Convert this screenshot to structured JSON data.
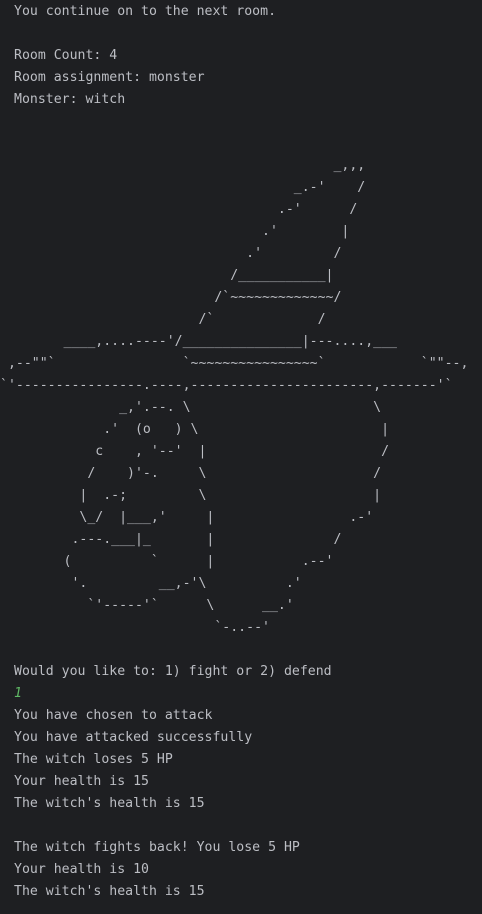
{
  "console": {
    "intro": "You continue on to the next room.",
    "room_count": "Room Count: 4",
    "room_assignment": "Room assignment: monster",
    "monster": "Monster: witch",
    "ascii_art": "                                          _,,,\n                                     _.-'    /\n                                   .-'      /\n                                 .'        |\n                               .'         /\n                             /___________|\n                           /`~~~~~~~~~~~~~/\n                         /`             /\n        ____,....----'/_______________|---....,___\n ,--\"\"`                `~~~~~~~~~~~~~~~~`            `\"\"--,\n`'----------------.----,-----------------------,-------'`\n               _,'.--. \\                       \\\n             .'  (o   ) \\                       |\n            c    , '--'  |                      /\n           /    )'-.     \\                     /\n          |  .-;         \\                     |\n          \\_/  |___,'     |                 .-'\n         .---.___|_       |               /\n        (          `      |           .--'\n         '.         __,-'\\          .'\n           `'-----'`      \\      __.'\n                           `-..--'",
    "prompt": "Would you like to: 1) fight or 2) defend",
    "user_input": "1",
    "chosen": "You have chosen to attack",
    "attacked": "You have attacked successfully",
    "witch_loses": "The witch loses 5 HP",
    "your_health_1": "Your health is 15",
    "witch_health_1": "The witch's health is 15",
    "fights_back": "The witch fights back! You lose 5 HP",
    "your_health_2": "Your health is 10",
    "witch_health_2": "The witch's health is 15"
  },
  "colors": {
    "background": "#1e1f22",
    "text": "#bcbec4",
    "user_input": "#5fb865"
  }
}
